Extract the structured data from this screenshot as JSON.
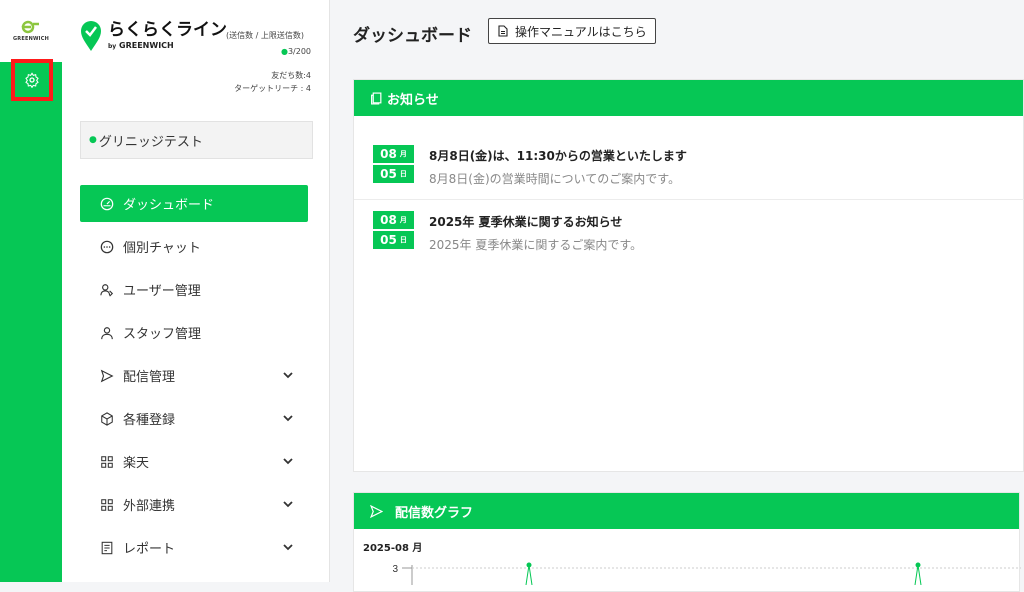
{
  "rail": {
    "logo_text": "GREENWICH"
  },
  "brand": {
    "name": "らくらくライン",
    "by": "by",
    "company": "GREENWICH",
    "send_label": "(送信数 / 上限送信数)",
    "send_count": "3/200",
    "friends": "友だち数:4",
    "target_reach": "ターゲットリーチ : 4"
  },
  "account": {
    "name": "グリニッジテスト"
  },
  "nav": [
    {
      "label": "ダッシュボード",
      "icon": "gauge-icon",
      "active": true
    },
    {
      "label": "個別チャット",
      "icon": "chat-icon"
    },
    {
      "label": "ユーザー管理",
      "icon": "users-icon"
    },
    {
      "label": "スタッフ管理",
      "icon": "user-icon"
    },
    {
      "label": "配信管理",
      "icon": "send-icon",
      "expandable": true
    },
    {
      "label": "各種登録",
      "icon": "cube-icon",
      "expandable": true
    },
    {
      "label": "楽天",
      "icon": "grid-icon",
      "expandable": true
    },
    {
      "label": "外部連携",
      "icon": "grid-icon",
      "expandable": true
    },
    {
      "label": "レポート",
      "icon": "report-icon",
      "expandable": true
    }
  ],
  "header": {
    "title": "ダッシュボード",
    "manual_button": "操作マニュアルはこちら"
  },
  "news": {
    "title": "お知らせ",
    "items": [
      {
        "month": "08",
        "month_unit": "月",
        "day": "05",
        "day_unit": "日",
        "title": "8月8日(金)は、11:30からの営業といたします",
        "desc": "8月8日(金)の営業時間についてのご案内です。"
      },
      {
        "month": "08",
        "month_unit": "月",
        "day": "05",
        "day_unit": "日",
        "title": "2025年 夏季休業に関するお知らせ",
        "desc": "2025年 夏季休業に関するご案内です。"
      }
    ]
  },
  "graph": {
    "title": "配信数グラフ",
    "month": "2025-08 月",
    "y_tick": "3"
  },
  "colors": {
    "brand_green": "#06c755",
    "highlight_red": "#ff1a1a"
  }
}
